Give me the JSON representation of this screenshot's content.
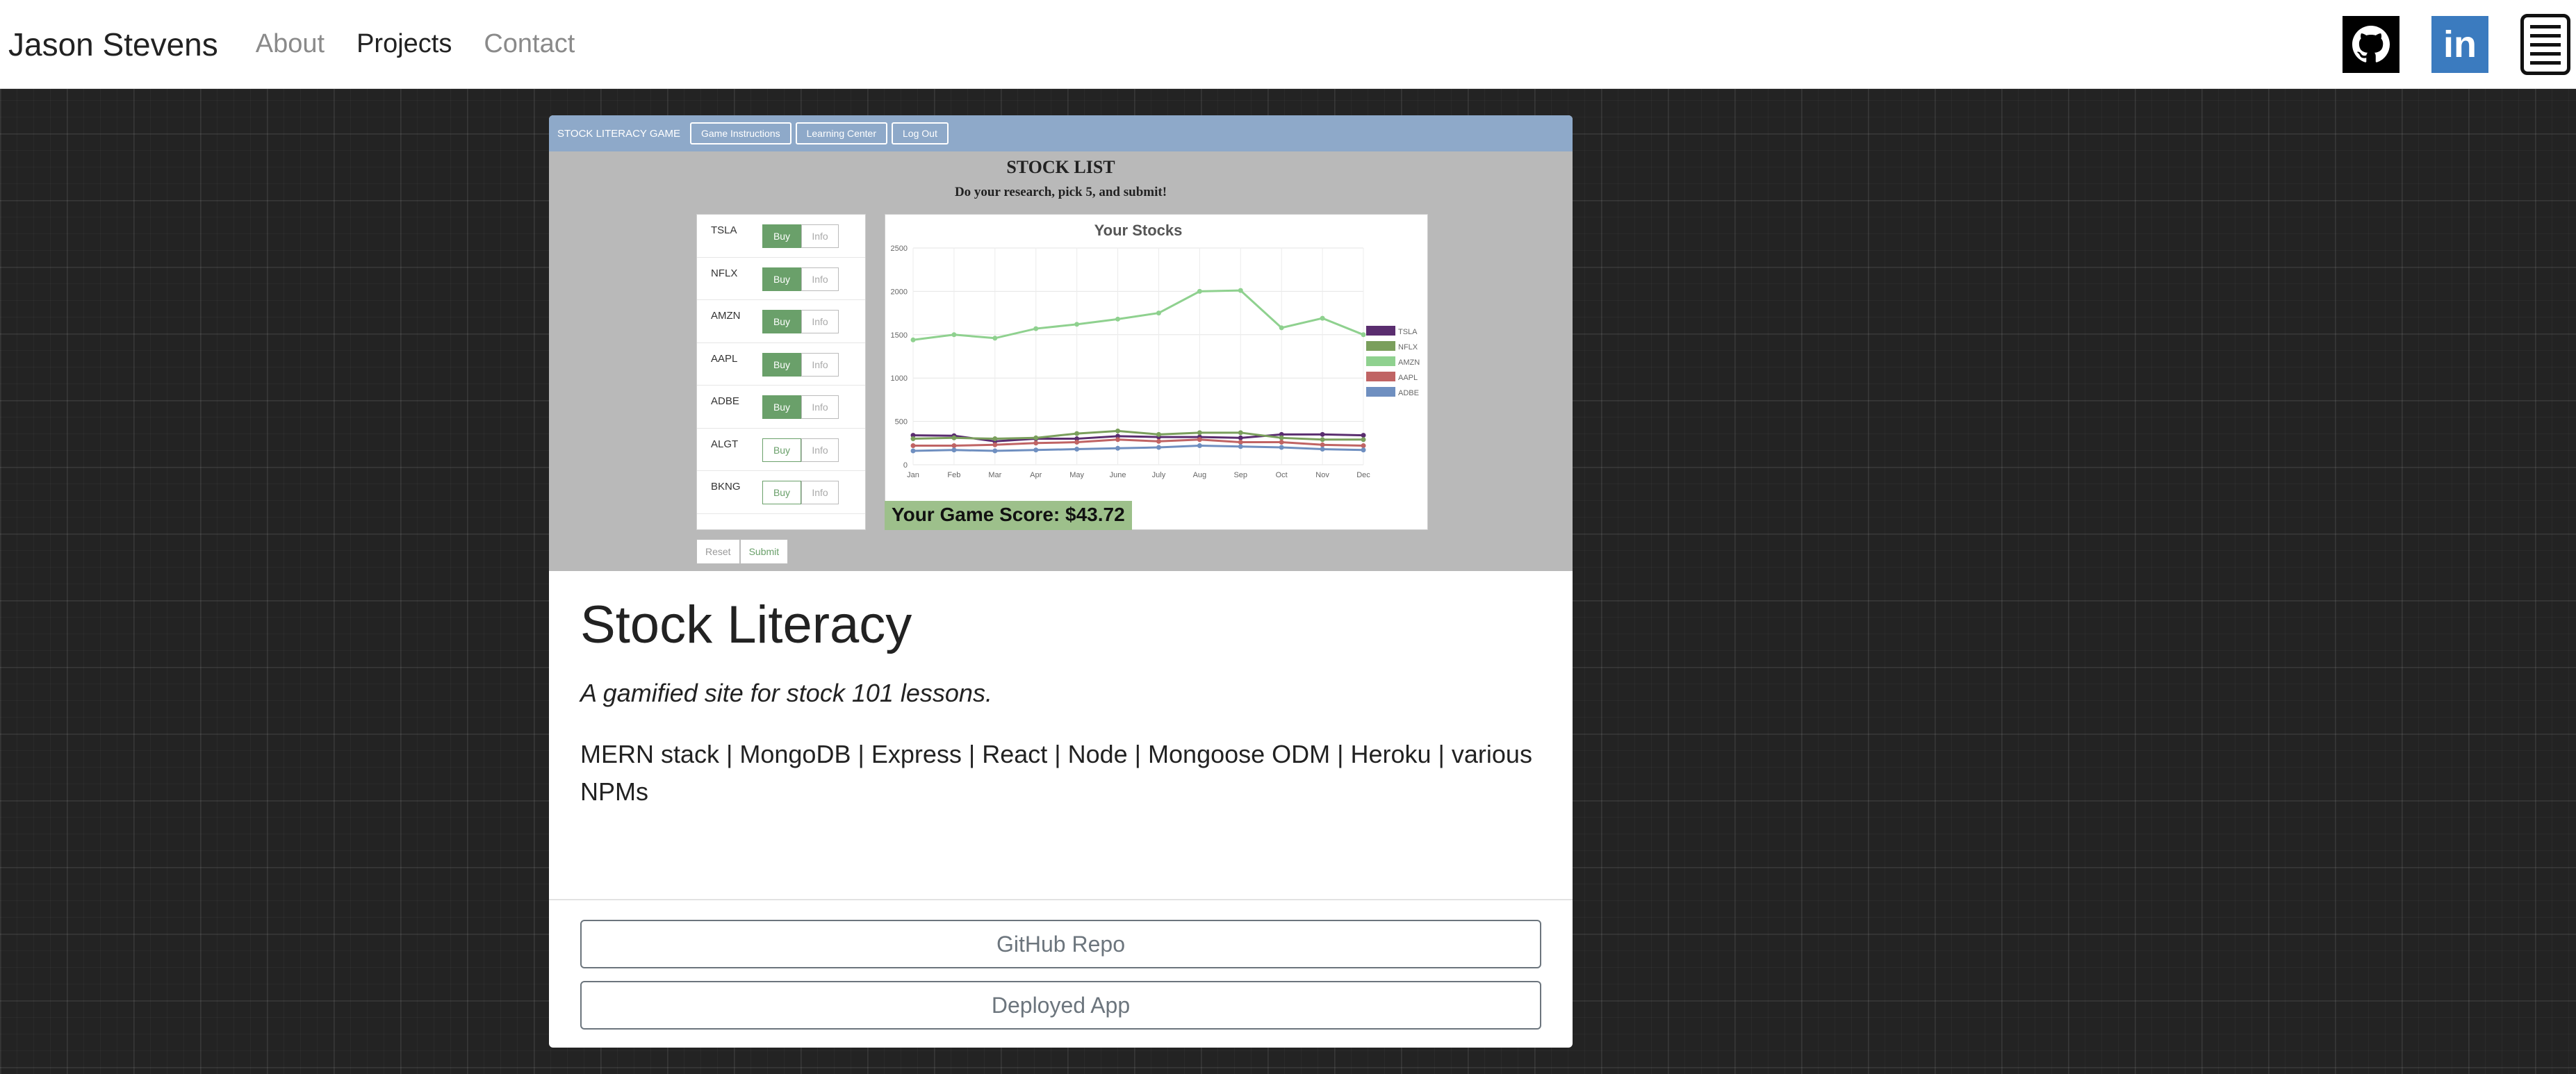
{
  "nav": {
    "brand": "Jason Stevens",
    "links": [
      {
        "label": "About",
        "active": false
      },
      {
        "label": "Projects",
        "active": true
      },
      {
        "label": "Contact",
        "active": false
      }
    ],
    "icons": [
      "github-icon",
      "linkedin-icon",
      "resume-icon"
    ],
    "linkedin_text": "in"
  },
  "project": {
    "screenshot": {
      "app_title": "STOCK LITERACY GAME",
      "app_buttons": [
        "Game Instructions",
        "Learning Center",
        "Log Out"
      ],
      "list_title": "STOCK LIST",
      "list_subtitle": "Do your research, pick 5, and submit!",
      "stocks": [
        {
          "name": "TSLA",
          "buy_selected": true
        },
        {
          "name": "NFLX",
          "buy_selected": true
        },
        {
          "name": "AMZN",
          "buy_selected": true
        },
        {
          "name": "AAPL",
          "buy_selected": true
        },
        {
          "name": "ADBE",
          "buy_selected": true
        },
        {
          "name": "ALGT",
          "buy_selected": false
        },
        {
          "name": "BKNG",
          "buy_selected": false
        }
      ],
      "buy_label": "Buy",
      "info_label": "Info",
      "reset_label": "Reset",
      "submit_label": "Submit",
      "score": "Your Game Score: $43.72"
    },
    "title": "Stock Literacy",
    "description": "A gamified site for stock 101 lessons.",
    "tech": "MERN stack | MongoDB | Express | React | Node | Mongoose ODM | Heroku | various NPMs",
    "buttons": {
      "github": "GitHub Repo",
      "deployed": "Deployed App"
    }
  },
  "colors": {
    "accent": "#8ea9c9",
    "buy_green": "#6aa06a",
    "score_bg": "#9dc08b"
  },
  "chart_data": {
    "type": "line",
    "title": "Your Stocks",
    "categories": [
      "Jan",
      "Feb",
      "Mar",
      "Apr",
      "May",
      "June",
      "July",
      "Aug",
      "Sep",
      "Oct",
      "Nov",
      "Dec"
    ],
    "ylim": [
      0,
      2500
    ],
    "yticks": [
      0,
      500,
      1000,
      1500,
      2000,
      2500
    ],
    "legend_position": "right",
    "series": [
      {
        "name": "TSLA",
        "color": "#5a2d6f",
        "values": [
          340,
          335,
          270,
          300,
          300,
          330,
          320,
          320,
          310,
          350,
          350,
          340
        ]
      },
      {
        "name": "NFLX",
        "color": "#7a9f5c",
        "values": [
          300,
          310,
          300,
          310,
          360,
          390,
          350,
          370,
          370,
          310,
          290,
          290
        ]
      },
      {
        "name": "AMZN",
        "color": "#8fd18f",
        "values": [
          1440,
          1500,
          1460,
          1570,
          1620,
          1680,
          1750,
          2000,
          2010,
          1580,
          1690,
          1500
        ]
      },
      {
        "name": "AAPL",
        "color": "#c06464",
        "values": [
          220,
          220,
          230,
          250,
          260,
          290,
          270,
          290,
          260,
          260,
          230,
          220
        ]
      },
      {
        "name": "ADBE",
        "color": "#6f8fc0",
        "values": [
          160,
          170,
          160,
          170,
          180,
          190,
          200,
          220,
          210,
          200,
          180,
          170
        ]
      }
    ]
  }
}
